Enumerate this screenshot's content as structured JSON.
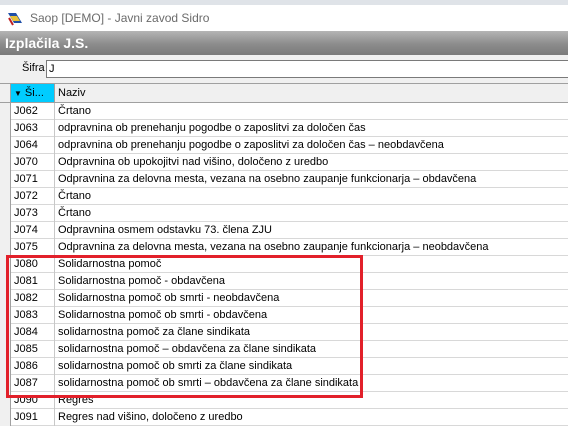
{
  "window": {
    "title": "Saop  [DEMO] - Javni zavod Sidro",
    "app_icon": "saop-app-icon"
  },
  "banner": {
    "title": "Izplačila J.S."
  },
  "search": {
    "label": "Šifra",
    "value": "J"
  },
  "table": {
    "columns": [
      {
        "label": "Ši..."
      },
      {
        "label": "Naziv"
      }
    ],
    "sort_column": "sifra",
    "header_accent": "#00ccff",
    "rows": [
      {
        "code": "J062",
        "name": "Črtano"
      },
      {
        "code": "J063",
        "name": "odpravnina ob prenehanju pogodbe o zaposlitvi za določen čas"
      },
      {
        "code": "J064",
        "name": "odpravnina ob prenehanju pogodbe o zaposlitvi za določen čas – neobdavčena"
      },
      {
        "code": "J070",
        "name": "Odpravnina ob upokojitvi nad višino, določeno z uredbo"
      },
      {
        "code": "J071",
        "name": "Odpravnina za delovna mesta, vezana na osebno zaupanje funkcionarja – obdavčena"
      },
      {
        "code": "J072",
        "name": "Črtano"
      },
      {
        "code": "J073",
        "name": "Črtano"
      },
      {
        "code": "J074",
        "name": "Odpravnina osmem odstavku 73. člena ZJU"
      },
      {
        "code": "J075",
        "name": "Odpravnina za delovna mesta, vezana na osebno zaupanje funkcionarja – neobdavčena"
      },
      {
        "code": "J080",
        "name": "Solidarnostna pomoč"
      },
      {
        "code": "J081",
        "name": "Solidarnostna pomoč - obdavčena"
      },
      {
        "code": "J082",
        "name": "Solidarnostna pomoč ob smrti - neobdavčena"
      },
      {
        "code": "J083",
        "name": "Solidarnostna pomoč ob smrti - obdavčena"
      },
      {
        "code": "J084",
        "name": "solidarnostna pomoč za člane sindikata"
      },
      {
        "code": "J085",
        "name": "solidarnostna pomoč – obdavčena za člane sindikata"
      },
      {
        "code": "J086",
        "name": "solidarnostna pomoč ob smrti za člane sindikata"
      },
      {
        "code": "J087",
        "name": "solidarnostna pomoč ob smrti – obdavčena za člane sindikata"
      },
      {
        "code": "J090",
        "name": "Regres"
      },
      {
        "code": "J091",
        "name": "Regres nad višino, določeno z uredbo"
      }
    ]
  },
  "annotation": {
    "highlight_color": "#e2202a"
  }
}
